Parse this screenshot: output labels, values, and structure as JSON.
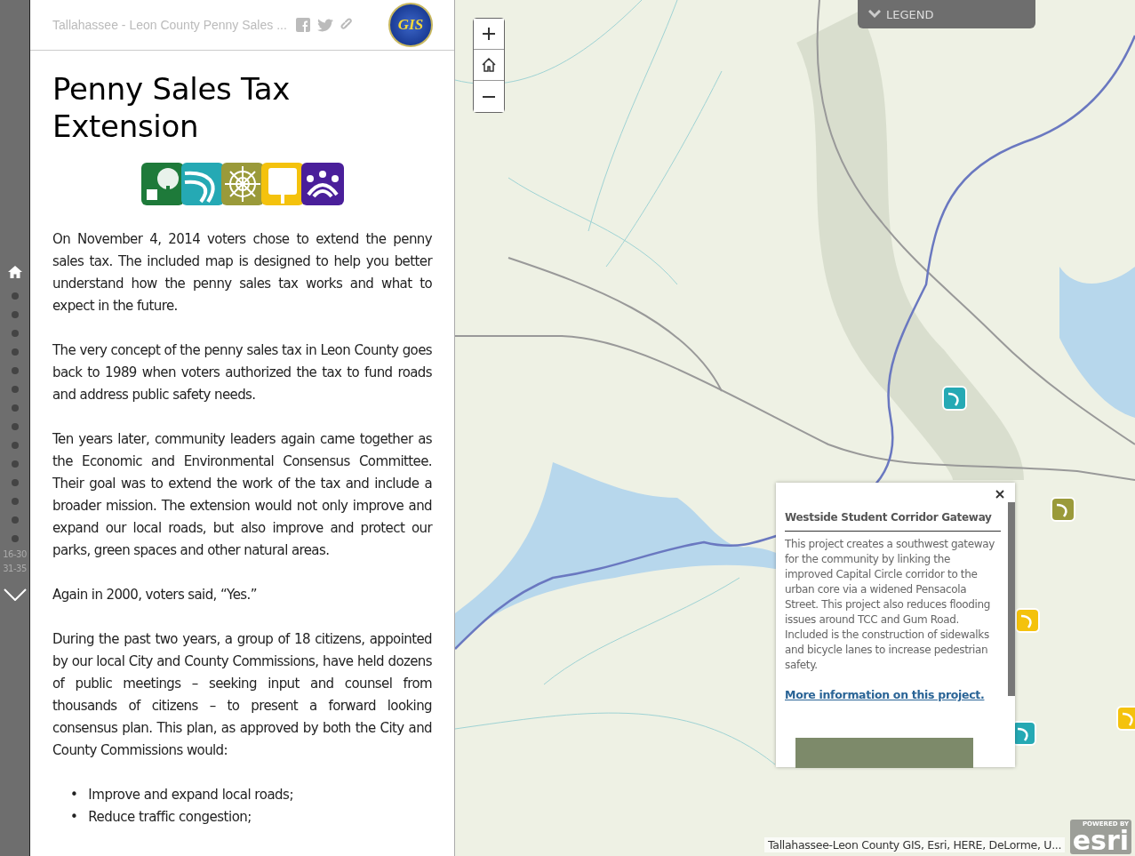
{
  "nav": {
    "items": [
      {
        "kind": "home",
        "selected": true
      },
      {
        "kind": "dot",
        "selected": false
      },
      {
        "kind": "dot",
        "selected": false
      },
      {
        "kind": "dot",
        "selected": false
      },
      {
        "kind": "dot",
        "selected": false
      },
      {
        "kind": "dot",
        "selected": false
      },
      {
        "kind": "dot",
        "selected": false
      },
      {
        "kind": "dot",
        "selected": false
      },
      {
        "kind": "dot",
        "selected": false
      },
      {
        "kind": "dot",
        "selected": false
      },
      {
        "kind": "dot",
        "selected": false
      },
      {
        "kind": "dot",
        "selected": false
      },
      {
        "kind": "dot",
        "selected": false
      },
      {
        "kind": "dot",
        "selected": false
      },
      {
        "kind": "dot",
        "selected": false
      }
    ],
    "ranges": [
      "16-30",
      "31-35"
    ]
  },
  "header": {
    "title": "Tallahassee - Leon County Penny Sales ...",
    "logo_text": "GIS"
  },
  "story": {
    "title": "Penny Sales Tax Extension",
    "category_icons": [
      {
        "kind": "parks"
      },
      {
        "kind": "roads"
      },
      {
        "kind": "safety"
      },
      {
        "kind": "facilities"
      },
      {
        "kind": "community"
      }
    ],
    "paragraphs": [
      "On November 4, 2014 voters chose to extend the penny sales tax. The included map is designed to help you better understand how the penny sales tax works and what to expect in the future.",
      "The very concept of the penny sales tax in Leon County goes back to 1989 when voters authorized the tax to fund roads and address public safety needs.",
      "Ten years later, community leaders again came together as the Economic and Environmental Consensus Committee. Their goal was to extend the work of the tax and include a broader mission. The extension would not only improve and expand our local roads, but also improve and protect our parks, green spaces and other natural areas.",
      "Again in 2000, voters said, “Yes.”",
      "During the past two years, a group of 18 citizens, appointed by our local City and County Commissions, have held dozens of public meetings – seeking input and counsel from thousands of citizens – to present a forward looking consensus plan. This plan, as approved by both the City and County Commissions would:"
    ],
    "bullets": [
      {
        "marker": "•",
        "text": "Improve and expand local roads;"
      },
      {
        "marker": "•",
        "text": "Reduce traffic congestion;"
      }
    ]
  },
  "map": {
    "legend": {
      "label": "LEGEND",
      "expanded": false
    },
    "markers": [
      {
        "kind": "roads"
      },
      {
        "kind": "safety"
      },
      {
        "kind": "facilities"
      },
      {
        "kind": "roads"
      },
      {
        "kind": "facilities"
      }
    ],
    "popup": {
      "title": "Westside Student Corridor Gateway",
      "body": "This project creates a southwest gateway for the community by linking the improved Capital Circle corridor to the urban core via a widened Pensacola Street. This project also reduces flooding issues around TCC and Gum Road. Included is the construction of sidewalks and bicycle lanes to increase pedestrian safety.",
      "link": "More information on this project."
    },
    "attribution": "Tallahassee-Leon County GIS, Esri, HERE, DeLorme, U...",
    "powered_by": "POWERED BY",
    "esri": "esri"
  }
}
